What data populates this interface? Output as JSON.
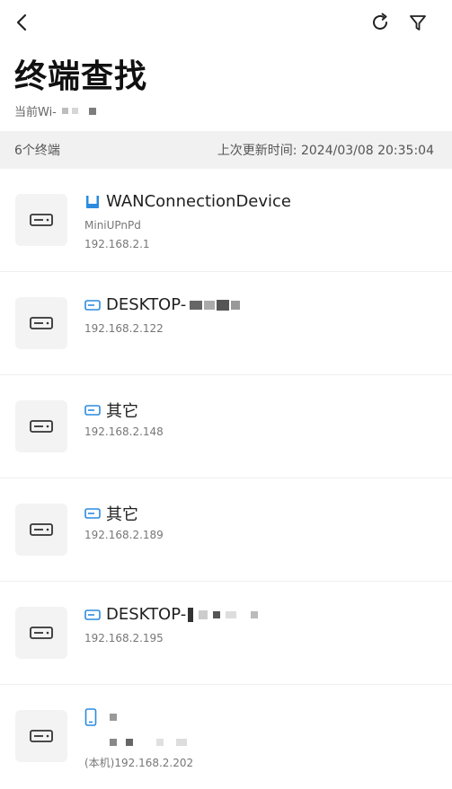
{
  "header": {
    "title": "终端查找",
    "wifi_prefix": "当前Wi-",
    "back_icon": "back-arrow-icon",
    "refresh_icon": "refresh-icon",
    "filter_icon": "filter-icon"
  },
  "summary": {
    "count_text": "6个终端",
    "updated_text": "上次更新时间: 2024/03/08  20:35:04"
  },
  "devices": [
    {
      "name": "WANConnectionDevice",
      "line2": "MiniUPnPd",
      "ip": "192.168.2.1",
      "type_icon": "router-icon"
    },
    {
      "name": "DESKTOP-",
      "ip": "192.168.2.122",
      "type_icon": "computer-icon"
    },
    {
      "name": "其它",
      "ip": "192.168.2.148",
      "type_icon": "computer-icon"
    },
    {
      "name": "其它",
      "ip": "192.168.2.189",
      "type_icon": "computer-icon"
    },
    {
      "name": "DESKTOP-",
      "ip": "192.168.2.195",
      "type_icon": "computer-icon"
    },
    {
      "name": "",
      "ip": "(本机)192.168.2.202",
      "type_icon": "phone-icon"
    }
  ],
  "colors": {
    "accent": "#2a8be0",
    "summary_bg": "#f1f1f1",
    "tile_bg": "#f3f3f3"
  }
}
